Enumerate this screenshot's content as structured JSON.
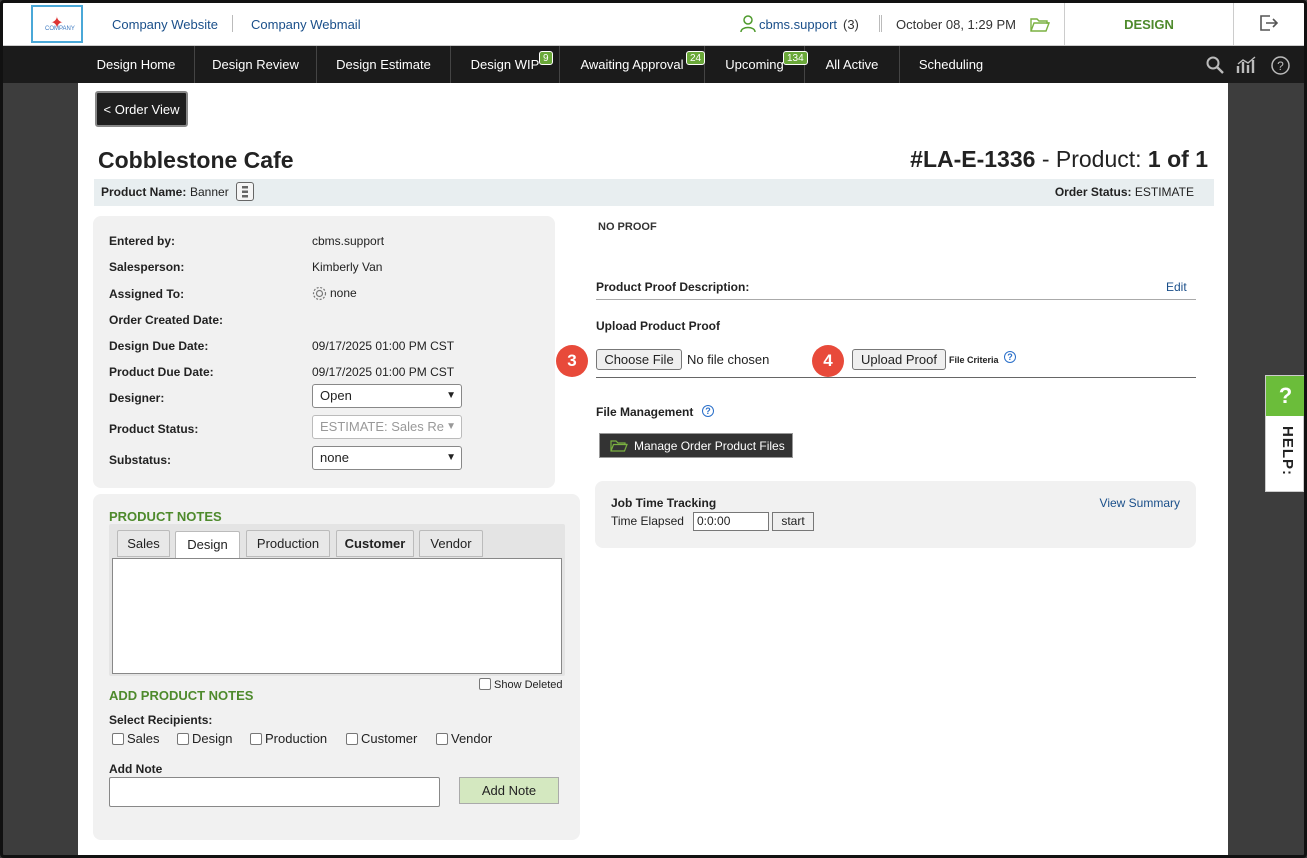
{
  "header": {
    "logo_text": "COMPANY",
    "link_website": "Company Website",
    "link_webmail": "Company Webmail",
    "user_name": "cbms.support",
    "user_count": "(3)",
    "datetime": "October 08, 1:29 PM",
    "section": "DESIGN"
  },
  "nav": {
    "items": [
      {
        "label": "Design Home"
      },
      {
        "label": "Design Review"
      },
      {
        "label": "Design Estimate"
      },
      {
        "label": "Design WIP",
        "badge": "9"
      },
      {
        "label": "Awaiting Approval",
        "badge": "24"
      },
      {
        "label": "Upcoming",
        "badge": "134"
      },
      {
        "label": "All Active"
      },
      {
        "label": "Scheduling"
      }
    ]
  },
  "page": {
    "back_label": "< Order View",
    "company": "Cobblestone Cafe",
    "order_id": "#LA-E-1336",
    "order_mid": " - Product: ",
    "order_count": "1 of 1",
    "product_name_label": "Product Name:",
    "product_name_value": "Banner",
    "order_status_label": "Order Status:",
    "order_status_value": "ESTIMATE"
  },
  "info": {
    "entered_by_label": "Entered by:",
    "entered_by": "cbms.support",
    "salesperson_label": "Salesperson:",
    "salesperson": "Kimberly Van",
    "assigned_label": "Assigned To:",
    "assigned": "none",
    "created_label": "Order Created Date:",
    "design_due_label": "Design Due Date:",
    "design_due": "09/17/2025 01:00 PM CST",
    "product_due_label": "Product Due Date:",
    "product_due": "09/17/2025 01:00 PM CST",
    "designer_label": "Designer:",
    "designer": "Open",
    "status_label": "Product Status:",
    "status": "ESTIMATE: Sales Re",
    "substatus_label": "Substatus:",
    "substatus": "none"
  },
  "notes": {
    "heading": "PRODUCT NOTES",
    "tabs": [
      "Sales",
      "Design",
      "Production",
      "Customer",
      "Vendor"
    ],
    "show_deleted": "Show Deleted",
    "add_heading": "ADD PRODUCT NOTES",
    "recipients_label": "Select Recipients:",
    "recipients": [
      "Sales",
      "Design",
      "Production",
      "Customer",
      "Vendor"
    ],
    "add_note_label": "Add Note",
    "add_note_button": "Add Note"
  },
  "proof": {
    "no_proof": "NO PROOF",
    "description_label": "Product Proof Description:",
    "edit": "Edit",
    "upload_label": "Upload Product Proof",
    "choose_file": "Choose File",
    "no_file": "No file chosen",
    "upload_button": "Upload Proof",
    "file_criteria": "File Criteria",
    "step_choose": "3",
    "step_upload": "4",
    "file_mgmt_label": "File Management",
    "manage_files": "Manage Order Product Files"
  },
  "time": {
    "title": "Job Time Tracking",
    "elapsed_label": "Time Elapsed",
    "elapsed_value": "0:0:00",
    "start": "start",
    "view_summary": "View Summary"
  },
  "help": {
    "q": "?",
    "label": "HELP:"
  },
  "colors": {
    "accent_green": "#4e8a2c",
    "link_blue": "#1a4f8a",
    "step_red": "#e84a3a",
    "nav_bg": "#1b1b1b"
  }
}
